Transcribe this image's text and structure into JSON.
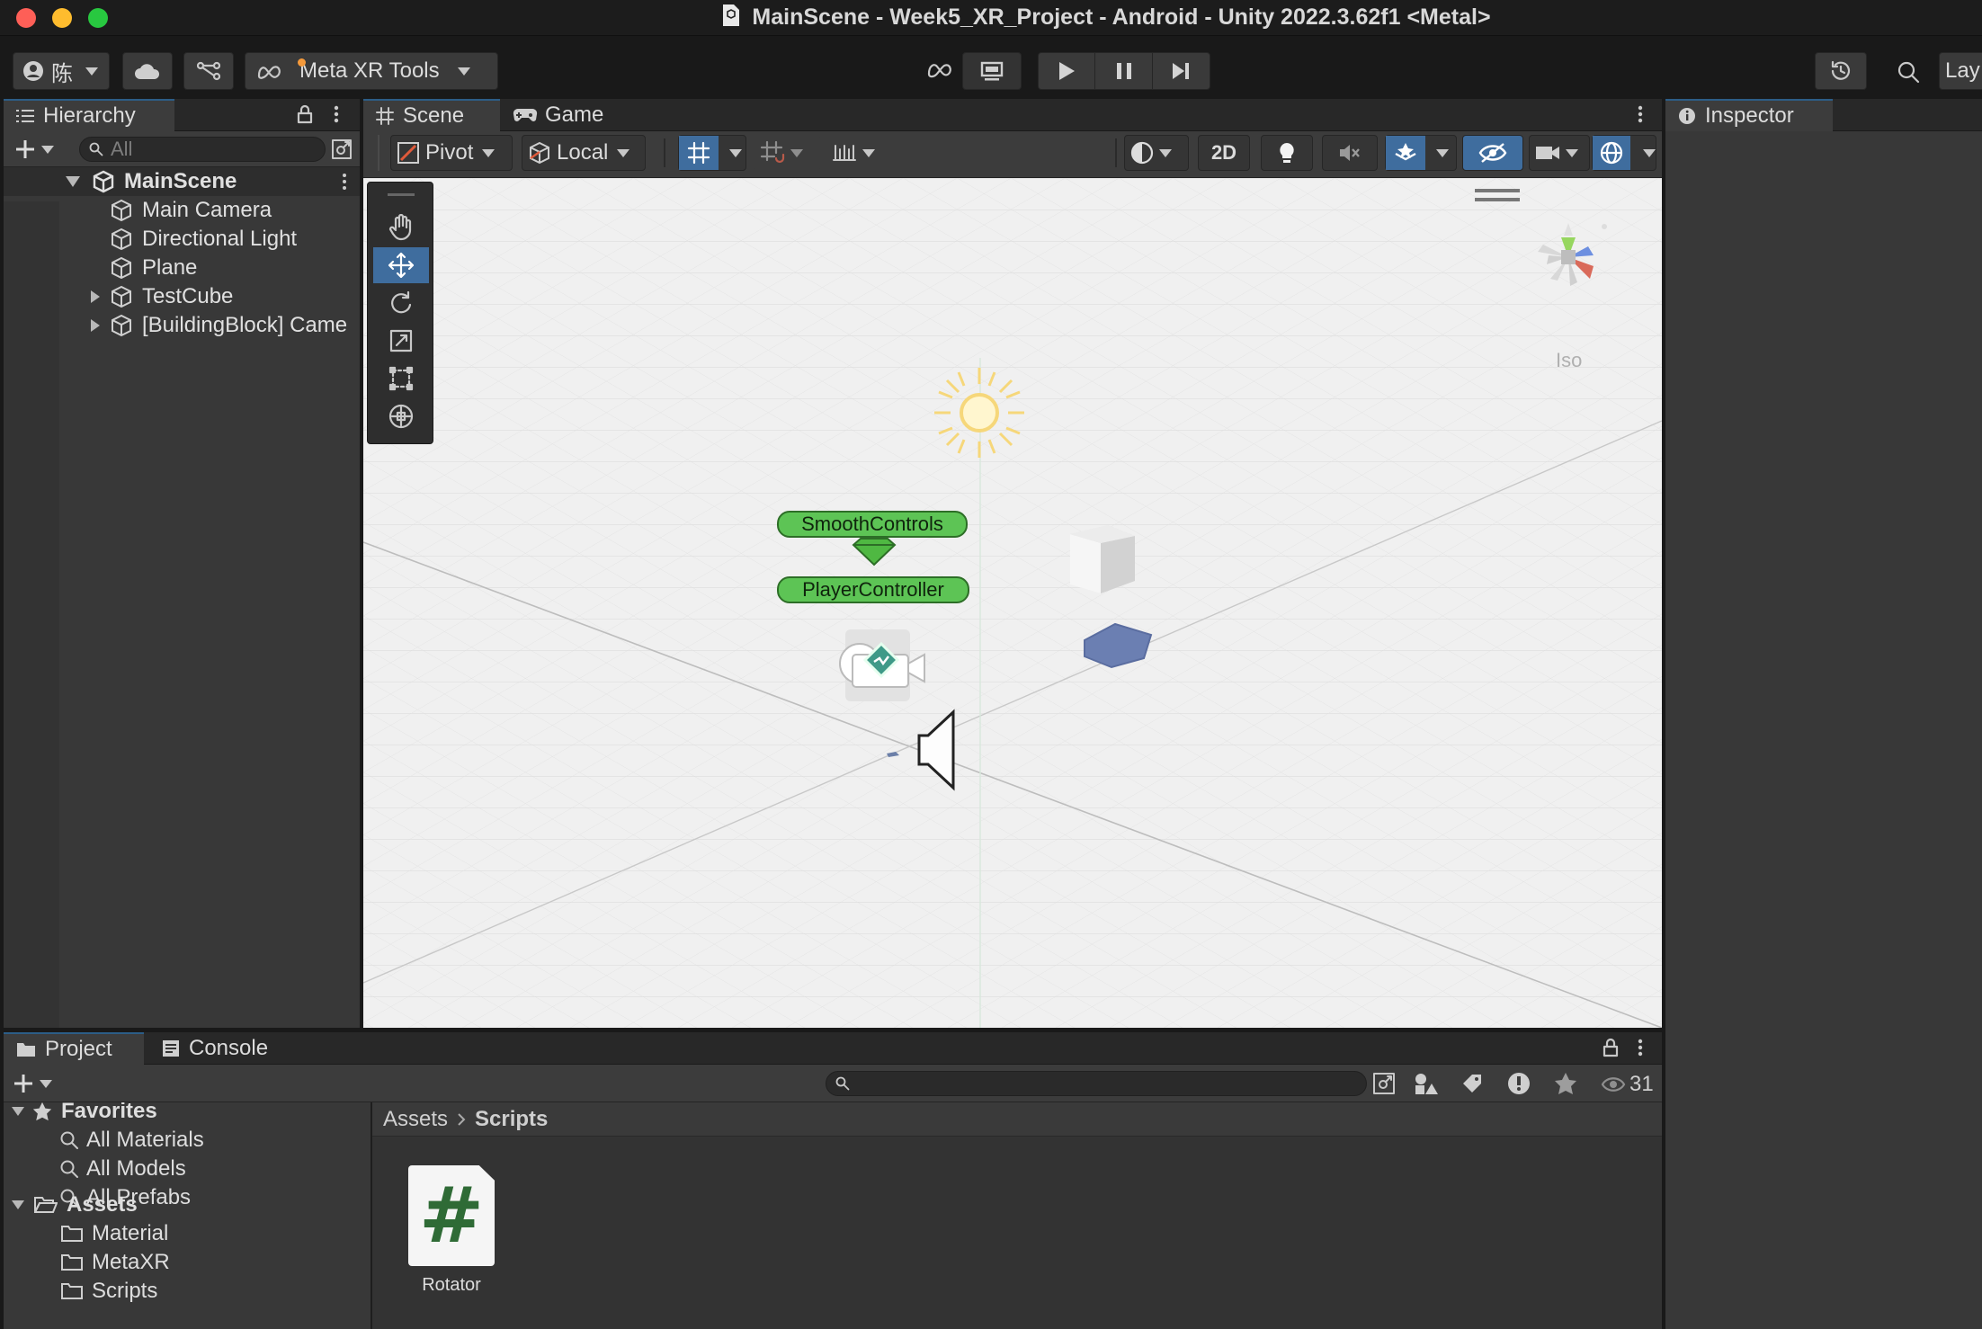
{
  "window": {
    "title": "MainScene - Week5_XR_Project - Android - Unity 2022.3.62f1 <Metal>"
  },
  "toolbar": {
    "account_label": "陈",
    "meta_label": "Meta XR Tools",
    "layout_label": "Lay"
  },
  "hierarchy": {
    "tab_label": "Hierarchy",
    "search_placeholder": "All",
    "scene_name": "MainScene",
    "items": [
      {
        "label": "Main Camera",
        "expandable": false
      },
      {
        "label": "Directional Light",
        "expandable": false
      },
      {
        "label": "Plane",
        "expandable": false
      },
      {
        "label": "TestCube",
        "expandable": true
      },
      {
        "label": "[BuildingBlock] Came",
        "expandable": true
      }
    ]
  },
  "scene": {
    "tabs": [
      "Scene",
      "Game"
    ],
    "pivot_label": "Pivot",
    "local_label": "Local",
    "mode_2d_label": "2D",
    "projection_label": "Iso",
    "gizmo_labels": [
      "SmoothControls",
      "PlayerController"
    ]
  },
  "inspector": {
    "tab_label": "Inspector"
  },
  "project": {
    "tabs": [
      "Project",
      "Console"
    ],
    "hidden_count": "31",
    "favorites_label": "Favorites",
    "favorites": [
      "All Materials",
      "All Models",
      "All Prefabs"
    ],
    "assets_label": "Assets",
    "asset_folders": [
      "Material",
      "MetaXR",
      "Scripts"
    ],
    "breadcrumb": [
      "Assets",
      "Scripts"
    ],
    "files": [
      {
        "name": "Rotator",
        "icon": "csharp-script-icon",
        "glyph": "#"
      }
    ]
  },
  "colors": {
    "accent": "#3f6d9e",
    "gizmo_green": "#5dc455",
    "script_green": "#2f6b36"
  }
}
